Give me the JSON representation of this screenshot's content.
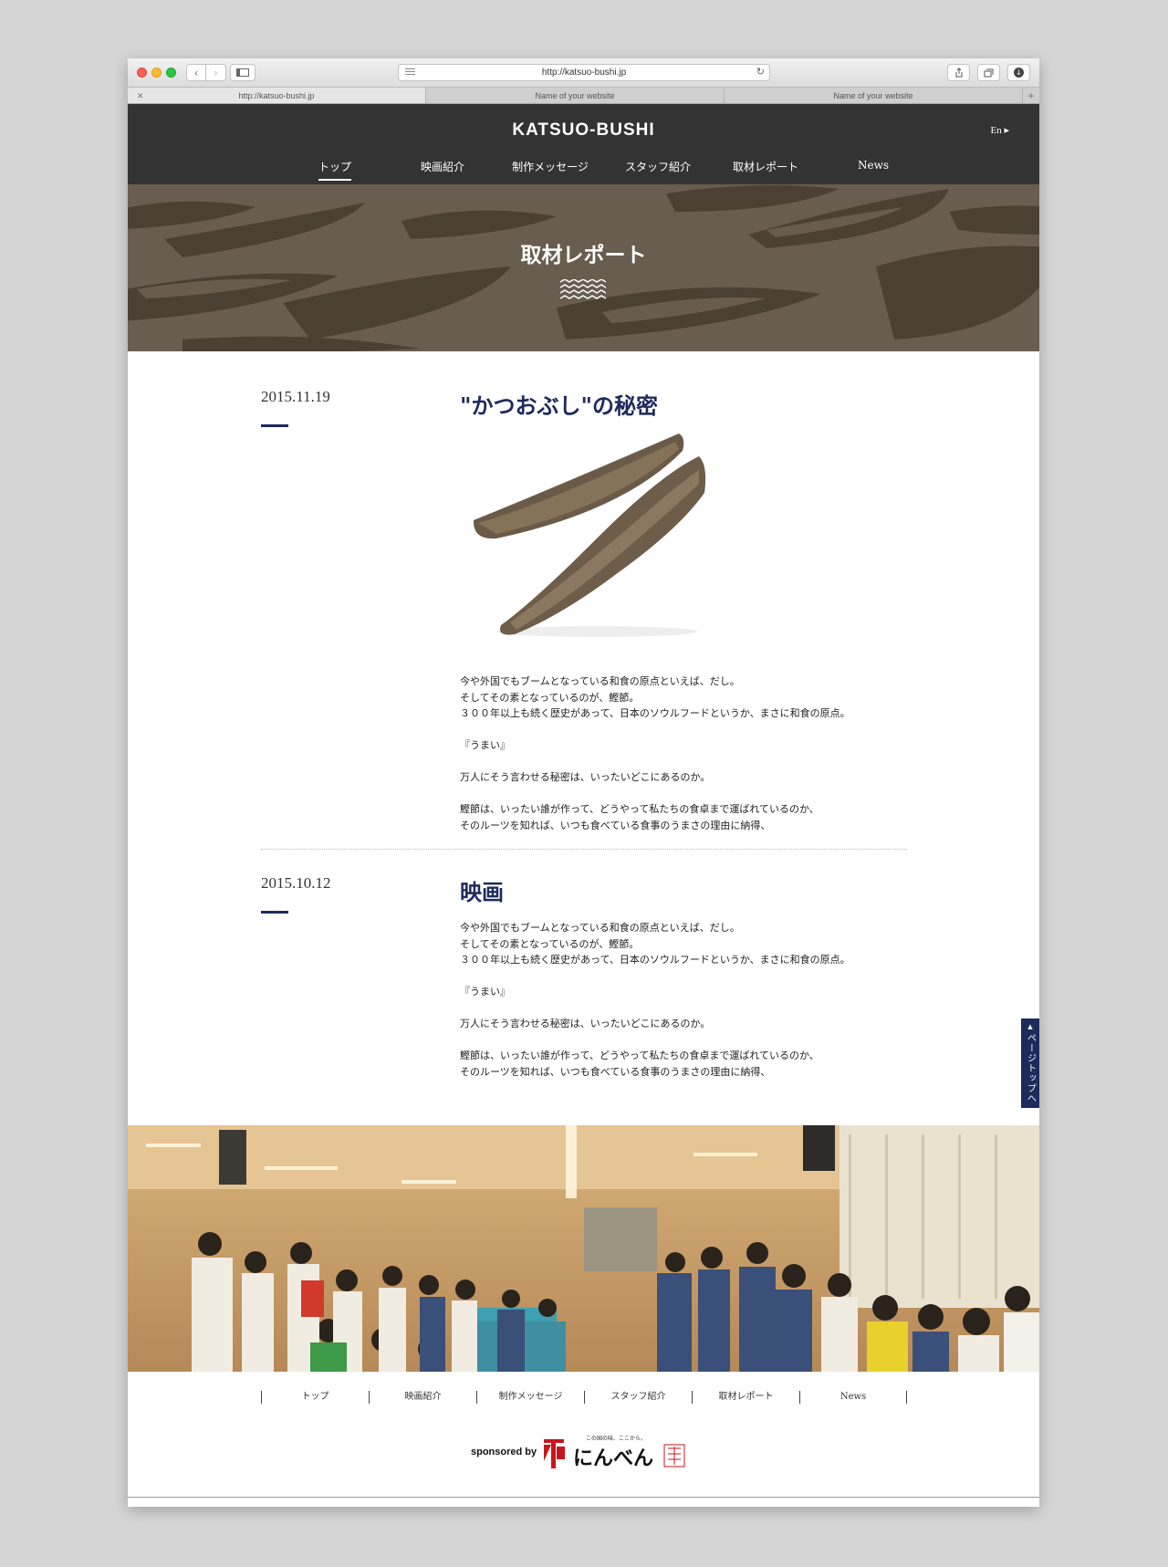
{
  "browser": {
    "url": "http://katsuo-bushi.jp",
    "tabs": [
      {
        "label": "http://katsuo-bushi.jp"
      },
      {
        "label": "Name of your website"
      },
      {
        "label": "Name of your website"
      }
    ],
    "back_icon": "‹",
    "forward_icon": "›",
    "reload_icon": "↻",
    "close_tab_icon": "✕",
    "new_tab_icon": "+"
  },
  "site": {
    "logo": "KATSUO-BUSHI",
    "lang": "En ▸",
    "nav": [
      "トップ",
      "映画紹介",
      "制作メッセージ",
      "スタッフ紹介",
      "取材レポート",
      "News"
    ],
    "active_nav": "トップ"
  },
  "hero": {
    "title": "取材レポート"
  },
  "posts": [
    {
      "date": "2015.11.19",
      "title": "\"かつおぶし\"の秘密",
      "has_image": true,
      "body": [
        "今や外国でもブームとなっている和食の原点といえば、だし。",
        "そしてその素となっているのが、鰹節。",
        "３００年以上も続く歴史があって、日本のソウルフードというか、まさに和食の原点。",
        "",
        "『うまい』",
        "",
        "万人にそう言わせる秘密は、いったいどこにあるのか。",
        "",
        "鰹節は、いったい誰が作って、どうやって私たちの食卓まで運ばれているのか、",
        "そのルーツを知れば、いつも食べている食事のうまさの理由に納得、"
      ]
    },
    {
      "date": "2015.10.12",
      "title": "映画",
      "has_image": false,
      "body": [
        "今や外国でもブームとなっている和食の原点といえば、だし。",
        "そしてその素となっているのが、鰹節。",
        "３００年以上も続く歴史があって、日本のソウルフードというか、まさに和食の原点。",
        "",
        "『うまい』",
        "",
        "万人にそう言わせる秘密は、いったいどこにあるのか。",
        "",
        "鰹節は、いったい誰が作って、どうやって私たちの食卓まで運ばれているのか、",
        "そのルーツを知れば、いつも食べている食事のうまさの理由に納得、"
      ]
    }
  ],
  "page_top": {
    "label": "ページトップへ",
    "arrow": "▲"
  },
  "footer": {
    "nav": [
      "トップ",
      "映画紹介",
      "制作メッセージ",
      "スタッフ紹介",
      "取材レポート",
      "News"
    ],
    "sponsored_by": "sponsored by",
    "sponsor_name": "にんべん",
    "sponsor_tagline": "この国の味、ここから。"
  },
  "colors": {
    "header_bg": "#333333",
    "accent_navy": "#1d2a5c",
    "sponsor_red": "#c8161d"
  }
}
